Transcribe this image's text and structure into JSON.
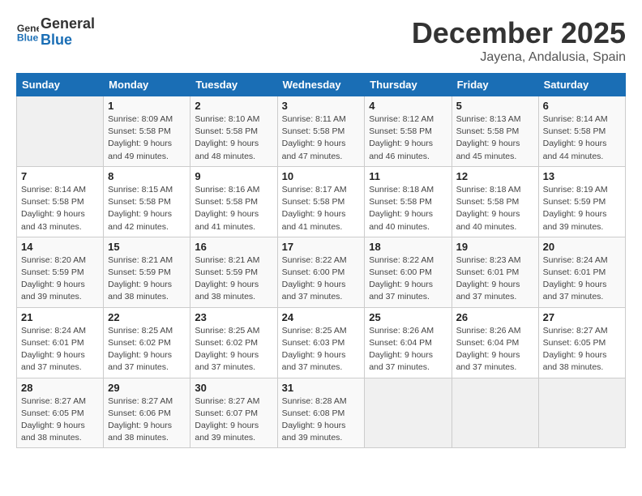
{
  "header": {
    "logo_line1": "General",
    "logo_line2": "Blue",
    "month_title": "December 2025",
    "subtitle": "Jayena, Andalusia, Spain"
  },
  "weekdays": [
    "Sunday",
    "Monday",
    "Tuesday",
    "Wednesday",
    "Thursday",
    "Friday",
    "Saturday"
  ],
  "weeks": [
    [
      {
        "day": "",
        "info": ""
      },
      {
        "day": "1",
        "info": "Sunrise: 8:09 AM\nSunset: 5:58 PM\nDaylight: 9 hours\nand 49 minutes."
      },
      {
        "day": "2",
        "info": "Sunrise: 8:10 AM\nSunset: 5:58 PM\nDaylight: 9 hours\nand 48 minutes."
      },
      {
        "day": "3",
        "info": "Sunrise: 8:11 AM\nSunset: 5:58 PM\nDaylight: 9 hours\nand 47 minutes."
      },
      {
        "day": "4",
        "info": "Sunrise: 8:12 AM\nSunset: 5:58 PM\nDaylight: 9 hours\nand 46 minutes."
      },
      {
        "day": "5",
        "info": "Sunrise: 8:13 AM\nSunset: 5:58 PM\nDaylight: 9 hours\nand 45 minutes."
      },
      {
        "day": "6",
        "info": "Sunrise: 8:14 AM\nSunset: 5:58 PM\nDaylight: 9 hours\nand 44 minutes."
      }
    ],
    [
      {
        "day": "7",
        "info": "Sunrise: 8:14 AM\nSunset: 5:58 PM\nDaylight: 9 hours\nand 43 minutes."
      },
      {
        "day": "8",
        "info": "Sunrise: 8:15 AM\nSunset: 5:58 PM\nDaylight: 9 hours\nand 42 minutes."
      },
      {
        "day": "9",
        "info": "Sunrise: 8:16 AM\nSunset: 5:58 PM\nDaylight: 9 hours\nand 41 minutes."
      },
      {
        "day": "10",
        "info": "Sunrise: 8:17 AM\nSunset: 5:58 PM\nDaylight: 9 hours\nand 41 minutes."
      },
      {
        "day": "11",
        "info": "Sunrise: 8:18 AM\nSunset: 5:58 PM\nDaylight: 9 hours\nand 40 minutes."
      },
      {
        "day": "12",
        "info": "Sunrise: 8:18 AM\nSunset: 5:58 PM\nDaylight: 9 hours\nand 40 minutes."
      },
      {
        "day": "13",
        "info": "Sunrise: 8:19 AM\nSunset: 5:59 PM\nDaylight: 9 hours\nand 39 minutes."
      }
    ],
    [
      {
        "day": "14",
        "info": "Sunrise: 8:20 AM\nSunset: 5:59 PM\nDaylight: 9 hours\nand 39 minutes."
      },
      {
        "day": "15",
        "info": "Sunrise: 8:21 AM\nSunset: 5:59 PM\nDaylight: 9 hours\nand 38 minutes."
      },
      {
        "day": "16",
        "info": "Sunrise: 8:21 AM\nSunset: 5:59 PM\nDaylight: 9 hours\nand 38 minutes."
      },
      {
        "day": "17",
        "info": "Sunrise: 8:22 AM\nSunset: 6:00 PM\nDaylight: 9 hours\nand 37 minutes."
      },
      {
        "day": "18",
        "info": "Sunrise: 8:22 AM\nSunset: 6:00 PM\nDaylight: 9 hours\nand 37 minutes."
      },
      {
        "day": "19",
        "info": "Sunrise: 8:23 AM\nSunset: 6:01 PM\nDaylight: 9 hours\nand 37 minutes."
      },
      {
        "day": "20",
        "info": "Sunrise: 8:24 AM\nSunset: 6:01 PM\nDaylight: 9 hours\nand 37 minutes."
      }
    ],
    [
      {
        "day": "21",
        "info": "Sunrise: 8:24 AM\nSunset: 6:01 PM\nDaylight: 9 hours\nand 37 minutes."
      },
      {
        "day": "22",
        "info": "Sunrise: 8:25 AM\nSunset: 6:02 PM\nDaylight: 9 hours\nand 37 minutes."
      },
      {
        "day": "23",
        "info": "Sunrise: 8:25 AM\nSunset: 6:02 PM\nDaylight: 9 hours\nand 37 minutes."
      },
      {
        "day": "24",
        "info": "Sunrise: 8:25 AM\nSunset: 6:03 PM\nDaylight: 9 hours\nand 37 minutes."
      },
      {
        "day": "25",
        "info": "Sunrise: 8:26 AM\nSunset: 6:04 PM\nDaylight: 9 hours\nand 37 minutes."
      },
      {
        "day": "26",
        "info": "Sunrise: 8:26 AM\nSunset: 6:04 PM\nDaylight: 9 hours\nand 37 minutes."
      },
      {
        "day": "27",
        "info": "Sunrise: 8:27 AM\nSunset: 6:05 PM\nDaylight: 9 hours\nand 38 minutes."
      }
    ],
    [
      {
        "day": "28",
        "info": "Sunrise: 8:27 AM\nSunset: 6:05 PM\nDaylight: 9 hours\nand 38 minutes."
      },
      {
        "day": "29",
        "info": "Sunrise: 8:27 AM\nSunset: 6:06 PM\nDaylight: 9 hours\nand 38 minutes."
      },
      {
        "day": "30",
        "info": "Sunrise: 8:27 AM\nSunset: 6:07 PM\nDaylight: 9 hours\nand 39 minutes."
      },
      {
        "day": "31",
        "info": "Sunrise: 8:28 AM\nSunset: 6:08 PM\nDaylight: 9 hours\nand 39 minutes."
      },
      {
        "day": "",
        "info": ""
      },
      {
        "day": "",
        "info": ""
      },
      {
        "day": "",
        "info": ""
      }
    ]
  ]
}
